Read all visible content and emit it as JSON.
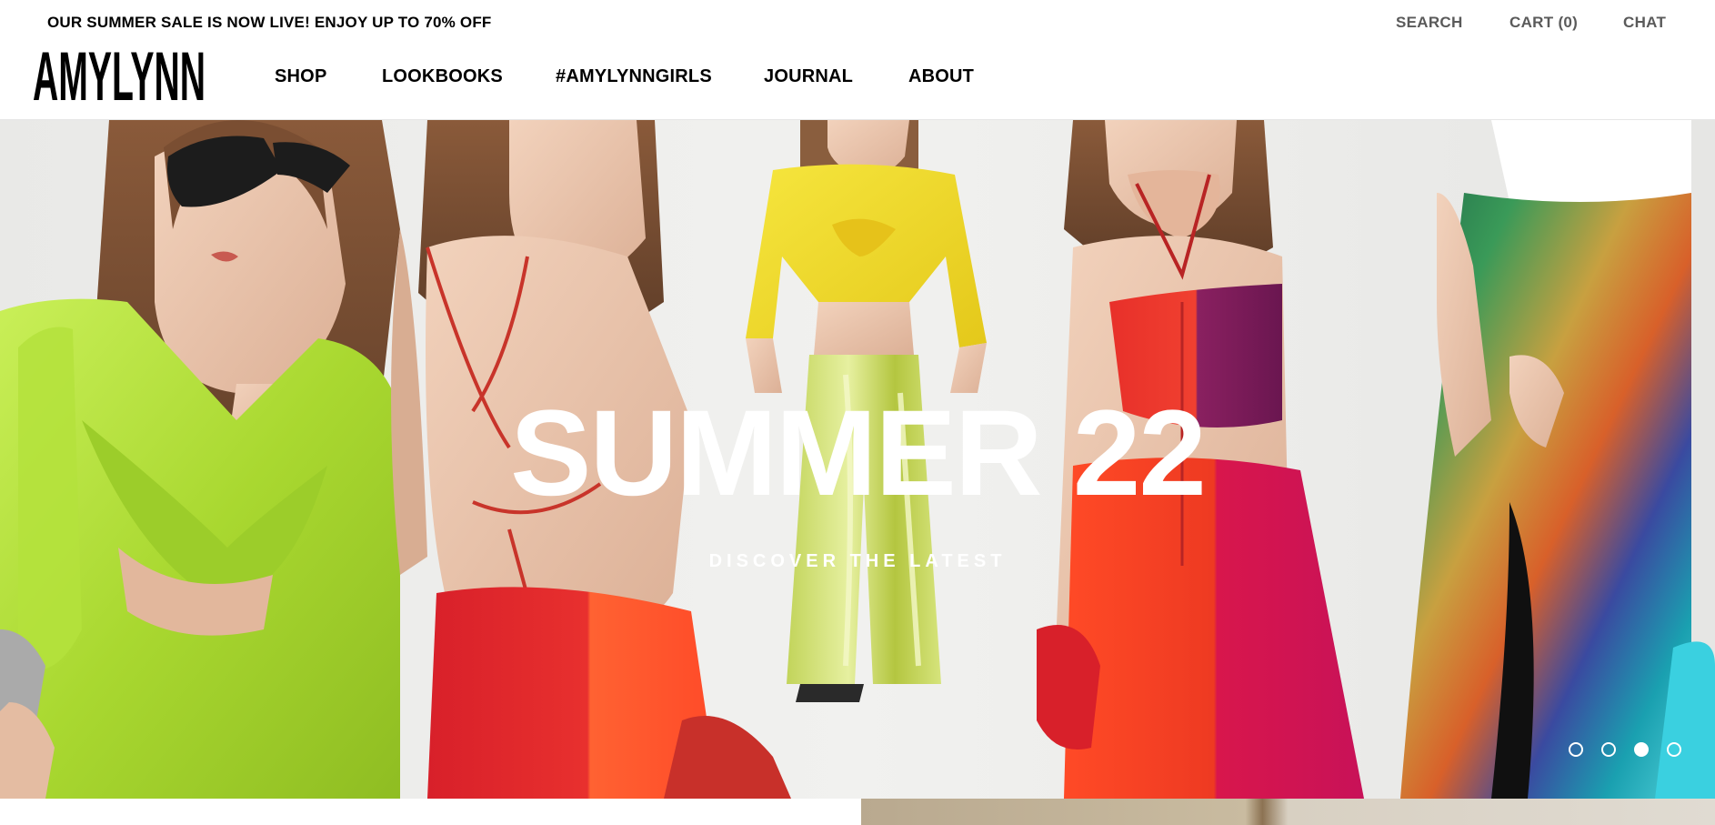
{
  "announcement": {
    "text": "OUR SUMMER SALE IS NOW LIVE! ENJOY UP TO 70% OFF"
  },
  "utility_nav": {
    "search": "SEARCH",
    "cart": "CART (0)",
    "chat": "CHAT"
  },
  "brand": {
    "logo_text": "AMYLYNN"
  },
  "main_nav": [
    {
      "label": "SHOP"
    },
    {
      "label": "LOOKBOOKS"
    },
    {
      "label": "#AMYLYNNGIRLS"
    },
    {
      "label": "JOURNAL"
    },
    {
      "label": "ABOUT"
    }
  ],
  "hero": {
    "title": "SUMMER 22",
    "subtitle": "DISCOVER THE LATEST",
    "slides_total": 4,
    "active_slide": 3
  },
  "colors": {
    "text": "#000000",
    "utility_text": "#5a5a5a",
    "hero_text": "#ffffff",
    "lime": "#b8e33a",
    "yellow": "#f2dc2a",
    "red": "#e0282e",
    "orange": "#ff5a2e",
    "purple": "#7a1a5a",
    "magenta": "#d11a5e"
  },
  "icons": {
    "slide_dot": "slide-dot-icon"
  }
}
